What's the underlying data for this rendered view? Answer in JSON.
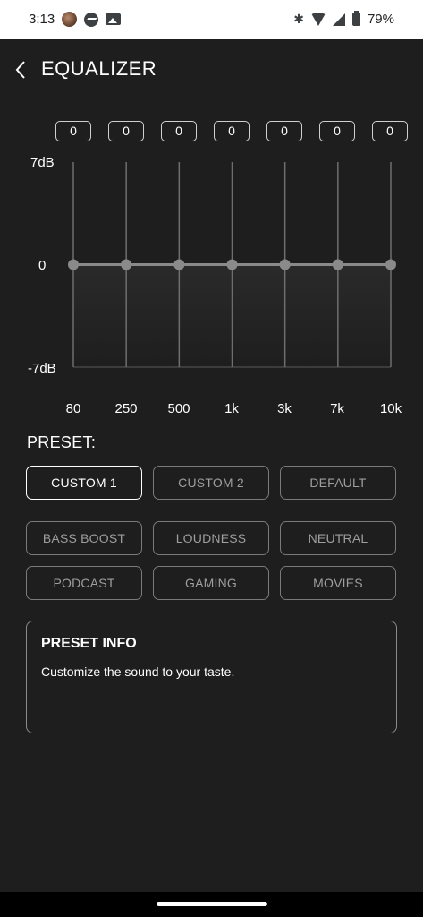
{
  "status_bar": {
    "time": "3:13",
    "battery": "79%",
    "icons": [
      "avatar-icon",
      "messenger-icon",
      "photos-icon",
      "bluetooth-icon",
      "wifi-icon",
      "signal-icon",
      "battery-icon"
    ]
  },
  "header": {
    "title": "EQUALIZER"
  },
  "equalizer": {
    "y_max_label": "7dB",
    "y_mid_label": "0",
    "y_min_label": "-7dB",
    "y_range_db": [
      -7,
      7
    ],
    "bands": [
      {
        "freq": "80",
        "value": "0"
      },
      {
        "freq": "250",
        "value": "0"
      },
      {
        "freq": "500",
        "value": "0"
      },
      {
        "freq": "1k",
        "value": "0"
      },
      {
        "freq": "3k",
        "value": "0"
      },
      {
        "freq": "7k",
        "value": "0"
      },
      {
        "freq": "10k",
        "value": "0"
      }
    ]
  },
  "presets": {
    "heading": "PRESET:",
    "items": [
      {
        "label": "CUSTOM 1",
        "active": true
      },
      {
        "label": "CUSTOM 2",
        "active": false
      },
      {
        "label": "DEFAULT",
        "active": false
      },
      {
        "label": "BASS BOOST",
        "active": false
      },
      {
        "label": "LOUDNESS",
        "active": false
      },
      {
        "label": "NEUTRAL",
        "active": false
      },
      {
        "label": "PODCAST",
        "active": false
      },
      {
        "label": "GAMING",
        "active": false
      },
      {
        "label": "MOVIES",
        "active": false
      }
    ]
  },
  "preset_info": {
    "title": "PRESET INFO",
    "text": "Customize the sound to your taste."
  },
  "colors": {
    "background": "#1e1e1e",
    "active_border": "#ffffff",
    "inactive_border": "#7a7a7a",
    "handle": "#8a8a8a"
  }
}
